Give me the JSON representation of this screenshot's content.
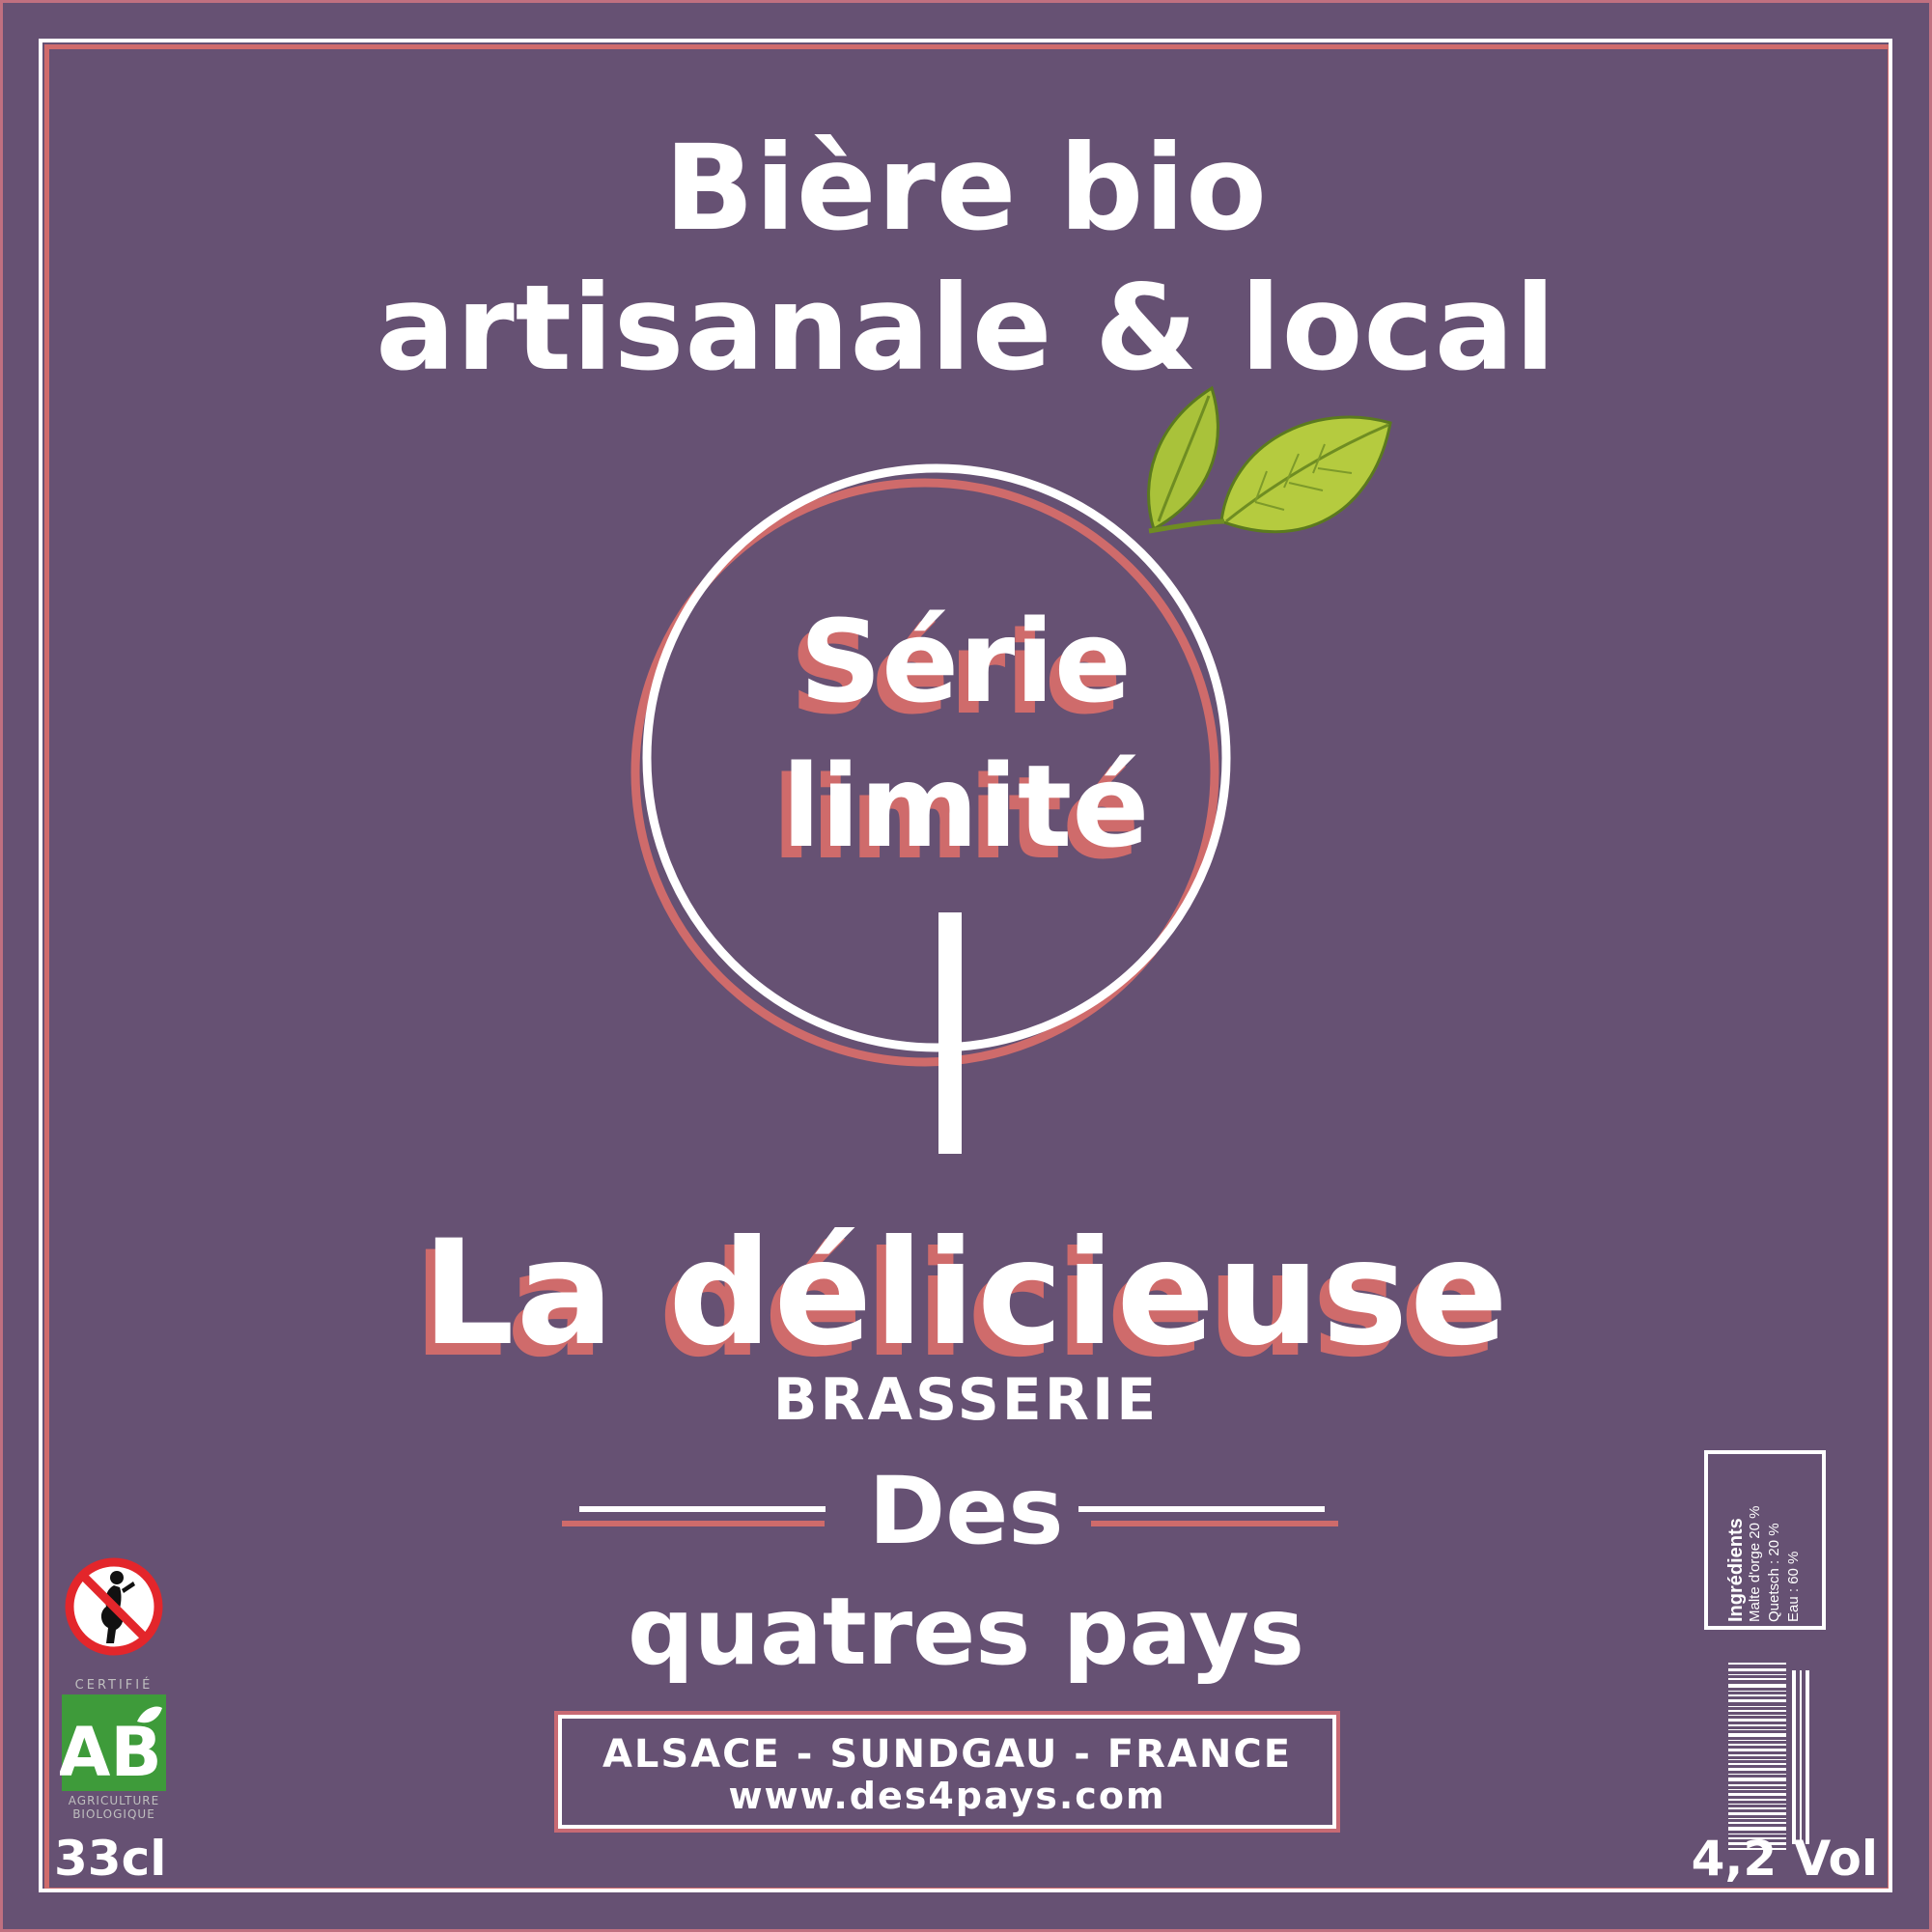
{
  "headline": {
    "line1": "Bière bio",
    "line2": "artisanale & local"
  },
  "emblem": {
    "line1": "Série",
    "line2": "limité",
    "leaf_icon": "leaf-icon"
  },
  "product": {
    "name": "La délicieuse"
  },
  "brewery": {
    "prefix": "BRASSERIE",
    "name_line1": "Des",
    "name_line2": "quatres pays"
  },
  "info": {
    "region": "ALSACE - SUNDGAU - FRANCE",
    "website": "www.des4pays.com"
  },
  "volume": "33cl",
  "abv": "4,2 Vol",
  "ingredients": {
    "title": "Ingrédients",
    "items": [
      "Malte d'orge 20 %",
      "Quetsch : 20 %",
      "Eau : 60 %"
    ]
  },
  "ab_logo": {
    "top_text": "CERTIFIÉ",
    "mark": "AB",
    "bottom_text_1": "AGRICULTURE",
    "bottom_text_2": "BIOLOGIQUE"
  },
  "colors": {
    "background": "#665173",
    "accent": "#cf6b6b",
    "text": "#ffffff",
    "leaf": "#a9c23a",
    "ab_green": "#3e9b3a"
  },
  "icons": [
    "pregnancy-warning-icon",
    "ab-organic-logo",
    "leaf-icon",
    "barcode"
  ]
}
